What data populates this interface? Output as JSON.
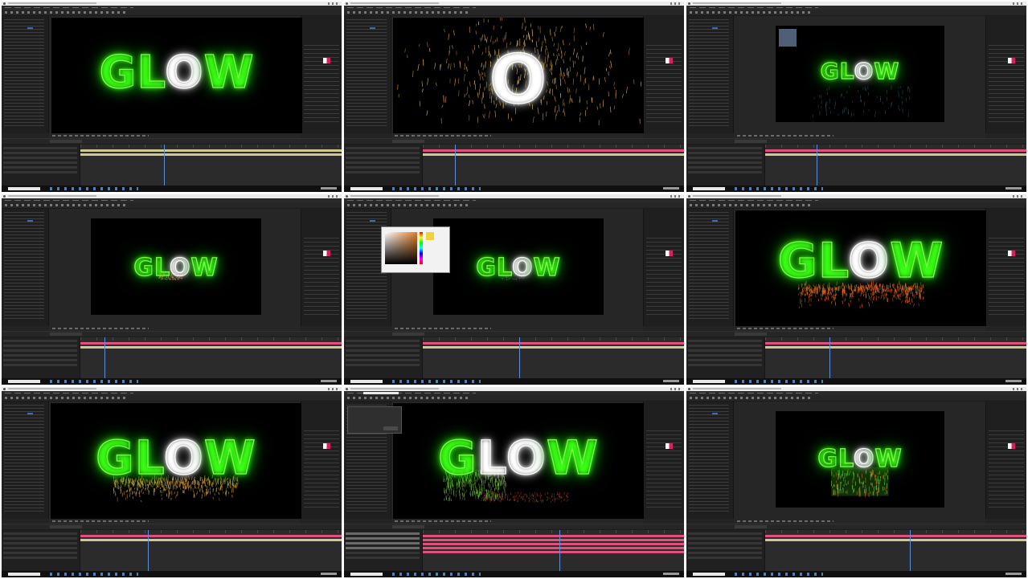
{
  "contact_sheet": {
    "columns": 3,
    "rows": 3,
    "app": "Adobe After Effects"
  },
  "frames": [
    {
      "id": "f1",
      "letters": [
        "G",
        "L",
        "O",
        "W"
      ],
      "white": [
        2
      ],
      "particles": "none",
      "bar": "#cfc894",
      "extra": "none"
    },
    {
      "id": "f2",
      "letters": [
        "O"
      ],
      "white": [
        0
      ],
      "particles": "burst",
      "bar": "#e0507a",
      "extra": "none"
    },
    {
      "id": "f3",
      "letters": [
        "G",
        "L",
        "O",
        "W"
      ],
      "white": [
        2
      ],
      "particles": "rain",
      "bar": "#e0507a",
      "extra": "solid-square"
    },
    {
      "id": "f4",
      "letters": [
        "G",
        "L",
        "O",
        "W"
      ],
      "white": [
        2
      ],
      "particles": "embers-small",
      "bar": "#e0507a",
      "extra": "none"
    },
    {
      "id": "f5",
      "letters": [
        "G",
        "L",
        "O",
        "W"
      ],
      "white": [
        2
      ],
      "particles": "faint",
      "bar": "#e0507a",
      "extra": "color-picker"
    },
    {
      "id": "f6",
      "letters": [
        "G",
        "L",
        "O",
        "W"
      ],
      "white": [
        2
      ],
      "particles": "embers",
      "bar": "#e0507a",
      "extra": "none"
    },
    {
      "id": "f7",
      "letters": [
        "G",
        "L",
        "O",
        "W"
      ],
      "white": [
        2
      ],
      "particles": "embers-gold",
      "bar": "#e0507a",
      "extra": "none"
    },
    {
      "id": "f8",
      "letters": [
        "G",
        "L",
        "O",
        "W"
      ],
      "white": [
        1,
        2
      ],
      "particles": "embers-green",
      "bar": "#e0507a",
      "extra": "dialog"
    },
    {
      "id": "f9",
      "letters": [
        "G",
        "L",
        "O",
        "W"
      ],
      "white": [
        2
      ],
      "particles": "reflection",
      "bar": "#e0507a",
      "extra": "none"
    }
  ],
  "colors": {
    "neon_green": "#39ff14",
    "neon_white": "#ffffff",
    "ember_orange": "#ff6a1a",
    "ember_gold": "#d9a23a",
    "timeline_pink": "#e0507a",
    "playhead_blue": "#5d8fd9"
  }
}
